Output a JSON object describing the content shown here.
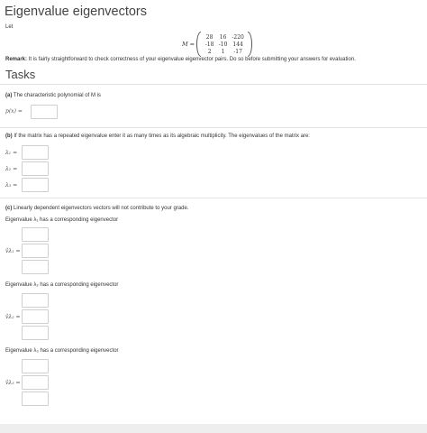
{
  "header": {
    "title": "Eigenvalue eigenvectors",
    "let": "Let"
  },
  "matrix": {
    "name": "M",
    "equals": "=",
    "rows": [
      [
        "28",
        "16",
        "-220"
      ],
      [
        "-18",
        "-10",
        "144"
      ],
      [
        "2",
        "1",
        "-17"
      ]
    ]
  },
  "remark": {
    "label": "Remark:",
    "text": " It is fairly straightforward to check correctness of your eigenvalue eigenvector pairs. Do so before submitting your answers for evaluation."
  },
  "tasks": {
    "title": "Tasks",
    "a": {
      "tag": "(a)",
      "text": " The characteristic polynomial of M is",
      "poly_label": "p(x) ="
    },
    "b": {
      "tag": "(b)",
      "text": " If the matrix has a repeated eigenvalue enter it as many times as its algebraic multiplicity. The eigenvalues of the matrix are:",
      "labels": [
        "λ₁ =",
        "λ₂ =",
        "λ₃ ="
      ]
    },
    "c": {
      "tag": "(c)",
      "text": " Linearly dependent eigenvectors vectors will not contribute to your grade.",
      "groups": [
        {
          "caption": "Eigenvalue λ₁ has a corresponding eigenvector",
          "label": "v̂λ₁ ="
        },
        {
          "caption": "Eigenvalue λ₂ has a corresponding eigenvector",
          "label": "v̂λ₂ ="
        },
        {
          "caption": "Eigenvalue λ₃ has a corresponding eigenvector",
          "label": "v̂λ₃ ="
        }
      ]
    }
  }
}
